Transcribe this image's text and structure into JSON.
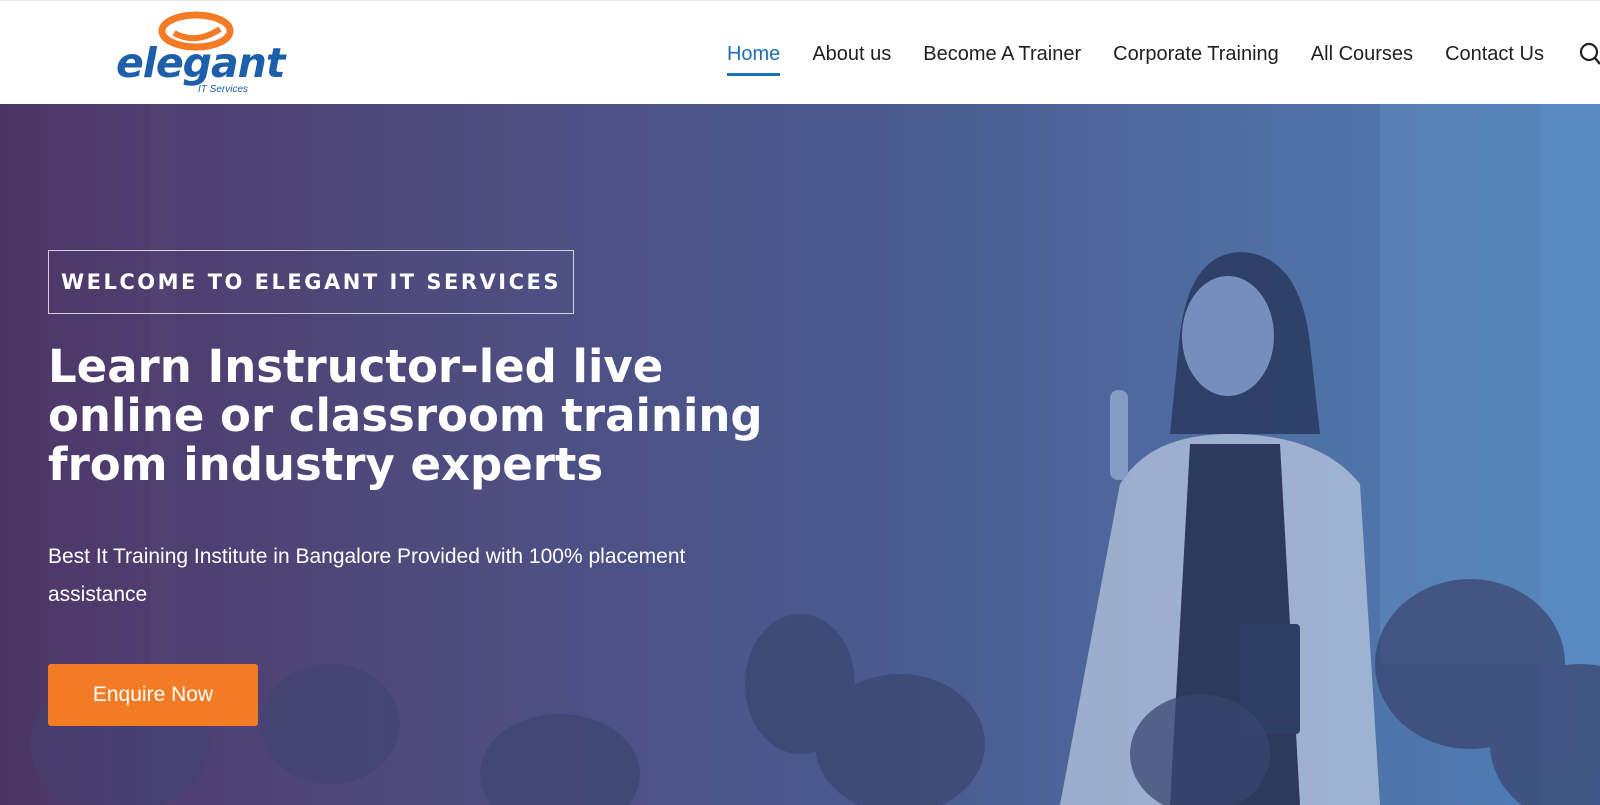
{
  "brand": {
    "logo_word": "elegant",
    "logo_sub": "IT Services",
    "accent_orange": "#f47b25",
    "accent_blue": "#1d6fb8"
  },
  "nav": {
    "items": [
      {
        "label": "Home",
        "active": true
      },
      {
        "label": "About us",
        "active": false
      },
      {
        "label": "Become A Trainer",
        "active": false
      },
      {
        "label": "Corporate Training",
        "active": false
      },
      {
        "label": "All Courses",
        "active": false
      },
      {
        "label": "Contact Us",
        "active": false
      }
    ],
    "search_icon": "search-icon"
  },
  "hero": {
    "welcome": "WELCOME TO ELEGANT IT SERVICES",
    "headline": "Learn Instructor-led live online or classroom training from industry experts",
    "subtext": "Best It Training Institute in Bangalore Provided with 100% placement assistance",
    "cta_label": "Enquire Now",
    "background_image": "instructor-presenting-to-class-photo"
  }
}
